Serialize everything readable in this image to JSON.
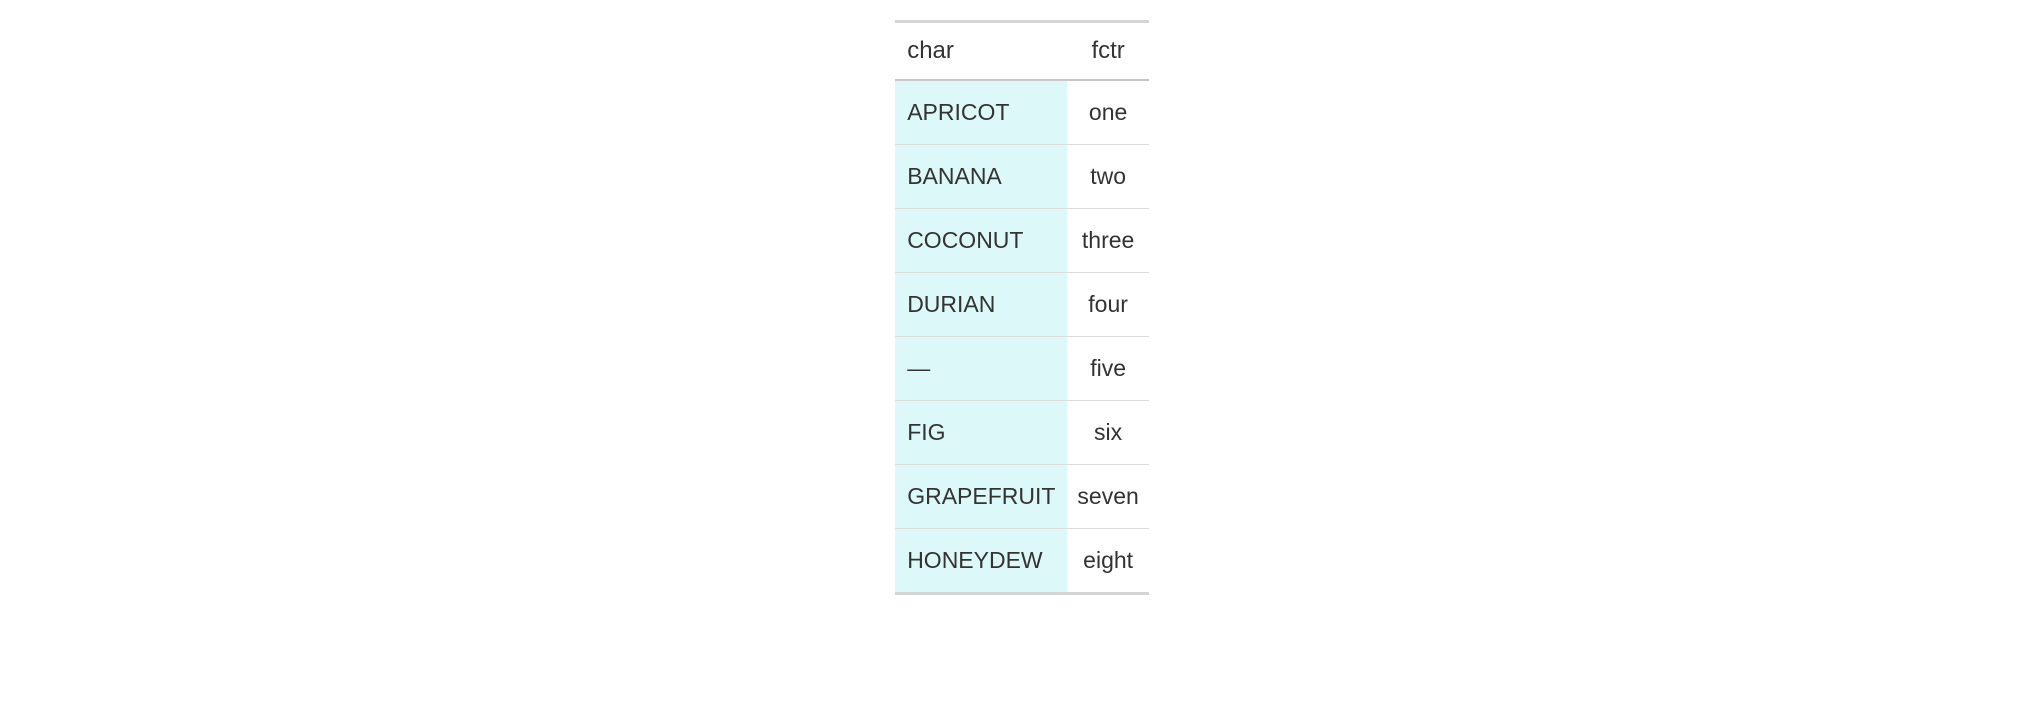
{
  "table": {
    "headers": {
      "char": "char",
      "fctr": "fctr"
    },
    "rows": [
      {
        "char": "APRICOT",
        "fctr": "one"
      },
      {
        "char": "BANANA",
        "fctr": "two"
      },
      {
        "char": "COCONUT",
        "fctr": "three"
      },
      {
        "char": "DURIAN",
        "fctr": "four"
      },
      {
        "char": "—",
        "fctr": "five"
      },
      {
        "char": "FIG",
        "fctr": "six"
      },
      {
        "char": "GRAPEFRUIT",
        "fctr": "seven"
      },
      {
        "char": "HONEYDEW",
        "fctr": "eight"
      }
    ]
  }
}
